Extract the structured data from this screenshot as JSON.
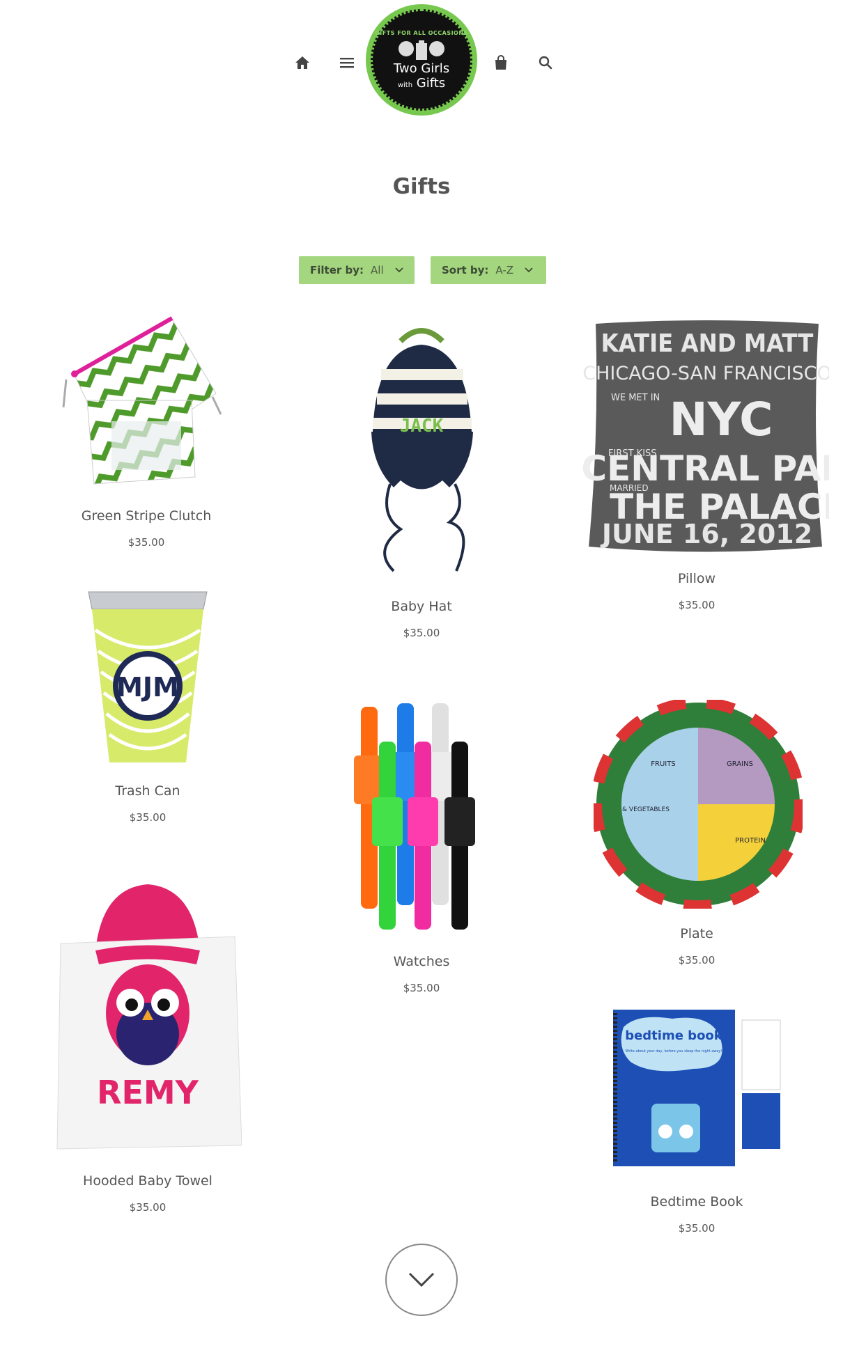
{
  "header": {
    "logo_tagline": "GIFTS FOR ALL OCCASIONS",
    "logo_line1": "Two Girls",
    "logo_line2_small": "with",
    "logo_line2": "Gifts"
  },
  "page": {
    "title": "Gifts"
  },
  "filters": {
    "filter_label": "Filter by:",
    "filter_value": "All",
    "sort_label": "Sort by:",
    "sort_value": "A-Z"
  },
  "products": [
    {
      "name": "Green Stripe Clutch",
      "price": "$35.00"
    },
    {
      "name": "Baby Hat",
      "price": "$35.00",
      "embroidery": "JACK"
    },
    {
      "name": "Pillow",
      "price": "$35.00",
      "pillow_text": [
        "KATIE AND MATT",
        "CHICAGO-SAN FRANCISCO",
        "WE MET IN",
        "NYC",
        "FIRST KISS",
        "CENTRAL PARK",
        "MARRIED",
        "THE PALACE",
        "JUNE 16, 2012"
      ]
    },
    {
      "name": "Trash Can",
      "price": "$35.00",
      "monogram": "MJM"
    },
    {
      "name": "Watches",
      "price": "$35.00"
    },
    {
      "name": "Plate",
      "price": "$35.00",
      "plate_labels": [
        "FRUITS",
        "& VEGETABLES",
        "GRAINS",
        "PROTEIN"
      ]
    },
    {
      "name": "Hooded Baby Towel",
      "price": "$35.00",
      "towel_name": "REMY"
    },
    {
      "name": "Bedtime Book",
      "price": "$35.00",
      "book_title": "bedtime book",
      "book_sub": "Write about your day, before you sleep the night away!"
    }
  ],
  "colors": {
    "accent": "#a3d67f",
    "logo_green": "#77c84e",
    "text": "#555555"
  },
  "icons": [
    "home-icon",
    "menu-icon",
    "bag-icon",
    "search-icon",
    "chevron-down-icon"
  ]
}
